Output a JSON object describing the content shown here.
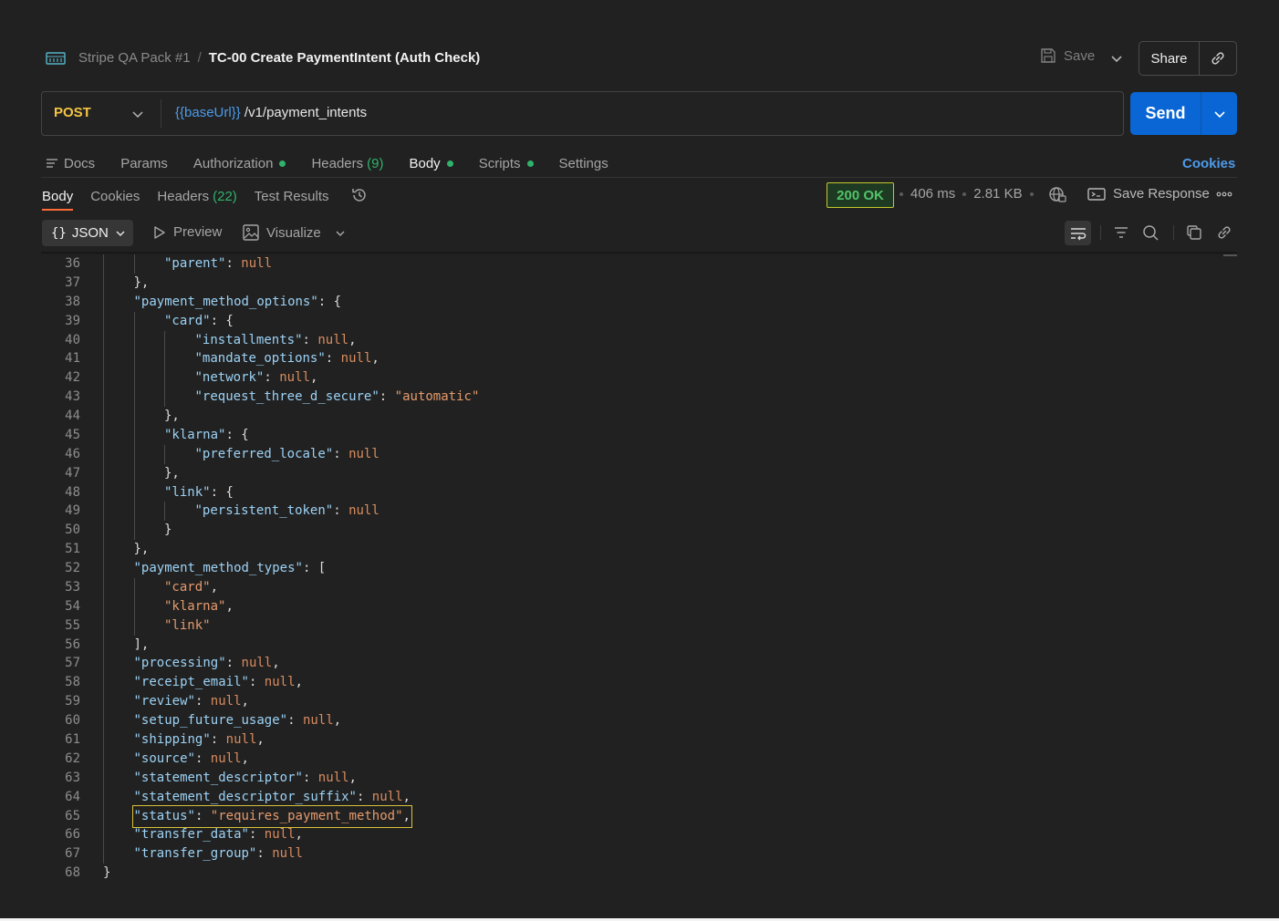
{
  "header": {
    "icon": "http-icon",
    "collection": "Stripe QA Pack #1",
    "separator": "/",
    "title": "TC-00 Create PaymentIntent (Auth Check)",
    "save_label": "Save",
    "share_label": "Share"
  },
  "request": {
    "method": "POST",
    "url_variable": "{{baseUrl}}",
    "url_path": "/v1/payment_intents",
    "send_label": "Send"
  },
  "request_tabs": {
    "docs": "Docs",
    "params": "Params",
    "authorization": "Authorization",
    "headers": "Headers",
    "headers_count": "(9)",
    "body": "Body",
    "scripts": "Scripts",
    "settings": "Settings",
    "cookies": "Cookies",
    "active": "Body",
    "dot_color": "#2fb26b"
  },
  "response_tabs": {
    "body": "Body",
    "cookies": "Cookies",
    "headers": "Headers",
    "headers_count": "(22)",
    "test_results": "Test Results",
    "active": "Body"
  },
  "response_meta": {
    "status": "200 OK",
    "time": "406 ms",
    "size": "2.81 KB",
    "save_response": "Save Response"
  },
  "body_toolbar": {
    "format_icon": "{}",
    "format": "JSON",
    "preview": "Preview",
    "visualize": "Visualize"
  },
  "editor": {
    "highlighted_line": 65,
    "lines": [
      {
        "n": "36",
        "indent": 2,
        "tokens": [
          {
            "t": "\"parent\"",
            "c": "key"
          },
          {
            "t": ": ",
            "c": "p"
          },
          {
            "t": "null",
            "c": "null"
          }
        ]
      },
      {
        "n": "37",
        "indent": 1,
        "tokens": [
          {
            "t": "},",
            "c": "p"
          }
        ]
      },
      {
        "n": "38",
        "indent": 1,
        "tokens": [
          {
            "t": "\"payment_method_options\"",
            "c": "key"
          },
          {
            "t": ": {",
            "c": "p"
          }
        ]
      },
      {
        "n": "39",
        "indent": 2,
        "tokens": [
          {
            "t": "\"card\"",
            "c": "key"
          },
          {
            "t": ": {",
            "c": "p"
          }
        ]
      },
      {
        "n": "40",
        "indent": 3,
        "tokens": [
          {
            "t": "\"installments\"",
            "c": "key"
          },
          {
            "t": ": ",
            "c": "p"
          },
          {
            "t": "null",
            "c": "null"
          },
          {
            "t": ",",
            "c": "p"
          }
        ]
      },
      {
        "n": "41",
        "indent": 3,
        "tokens": [
          {
            "t": "\"mandate_options\"",
            "c": "key"
          },
          {
            "t": ": ",
            "c": "p"
          },
          {
            "t": "null",
            "c": "null"
          },
          {
            "t": ",",
            "c": "p"
          }
        ]
      },
      {
        "n": "42",
        "indent": 3,
        "tokens": [
          {
            "t": "\"network\"",
            "c": "key"
          },
          {
            "t": ": ",
            "c": "p"
          },
          {
            "t": "null",
            "c": "null"
          },
          {
            "t": ",",
            "c": "p"
          }
        ]
      },
      {
        "n": "43",
        "indent": 3,
        "tokens": [
          {
            "t": "\"request_three_d_secure\"",
            "c": "key"
          },
          {
            "t": ": ",
            "c": "p"
          },
          {
            "t": "\"automatic\"",
            "c": "str"
          }
        ]
      },
      {
        "n": "44",
        "indent": 2,
        "tokens": [
          {
            "t": "},",
            "c": "p"
          }
        ]
      },
      {
        "n": "45",
        "indent": 2,
        "tokens": [
          {
            "t": "\"klarna\"",
            "c": "key"
          },
          {
            "t": ": {",
            "c": "p"
          }
        ]
      },
      {
        "n": "46",
        "indent": 3,
        "tokens": [
          {
            "t": "\"preferred_locale\"",
            "c": "key"
          },
          {
            "t": ": ",
            "c": "p"
          },
          {
            "t": "null",
            "c": "null"
          }
        ]
      },
      {
        "n": "47",
        "indent": 2,
        "tokens": [
          {
            "t": "},",
            "c": "p"
          }
        ]
      },
      {
        "n": "48",
        "indent": 2,
        "tokens": [
          {
            "t": "\"link\"",
            "c": "key"
          },
          {
            "t": ": {",
            "c": "p"
          }
        ]
      },
      {
        "n": "49",
        "indent": 3,
        "tokens": [
          {
            "t": "\"persistent_token\"",
            "c": "key"
          },
          {
            "t": ": ",
            "c": "p"
          },
          {
            "t": "null",
            "c": "null"
          }
        ]
      },
      {
        "n": "50",
        "indent": 2,
        "tokens": [
          {
            "t": "}",
            "c": "p"
          }
        ]
      },
      {
        "n": "51",
        "indent": 1,
        "tokens": [
          {
            "t": "},",
            "c": "p"
          }
        ]
      },
      {
        "n": "52",
        "indent": 1,
        "tokens": [
          {
            "t": "\"payment_method_types\"",
            "c": "key"
          },
          {
            "t": ": [",
            "c": "p"
          }
        ]
      },
      {
        "n": "53",
        "indent": 2,
        "tokens": [
          {
            "t": "\"card\"",
            "c": "str"
          },
          {
            "t": ",",
            "c": "p"
          }
        ]
      },
      {
        "n": "54",
        "indent": 2,
        "tokens": [
          {
            "t": "\"klarna\"",
            "c": "str"
          },
          {
            "t": ",",
            "c": "p"
          }
        ]
      },
      {
        "n": "55",
        "indent": 2,
        "tokens": [
          {
            "t": "\"link\"",
            "c": "str"
          }
        ]
      },
      {
        "n": "56",
        "indent": 1,
        "tokens": [
          {
            "t": "],",
            "c": "p"
          }
        ]
      },
      {
        "n": "57",
        "indent": 1,
        "tokens": [
          {
            "t": "\"processing\"",
            "c": "key"
          },
          {
            "t": ": ",
            "c": "p"
          },
          {
            "t": "null",
            "c": "null"
          },
          {
            "t": ",",
            "c": "p"
          }
        ]
      },
      {
        "n": "58",
        "indent": 1,
        "tokens": [
          {
            "t": "\"receipt_email\"",
            "c": "key"
          },
          {
            "t": ": ",
            "c": "p"
          },
          {
            "t": "null",
            "c": "null"
          },
          {
            "t": ",",
            "c": "p"
          }
        ]
      },
      {
        "n": "59",
        "indent": 1,
        "tokens": [
          {
            "t": "\"review\"",
            "c": "key"
          },
          {
            "t": ": ",
            "c": "p"
          },
          {
            "t": "null",
            "c": "null"
          },
          {
            "t": ",",
            "c": "p"
          }
        ]
      },
      {
        "n": "60",
        "indent": 1,
        "tokens": [
          {
            "t": "\"setup_future_usage\"",
            "c": "key"
          },
          {
            "t": ": ",
            "c": "p"
          },
          {
            "t": "null",
            "c": "null"
          },
          {
            "t": ",",
            "c": "p"
          }
        ]
      },
      {
        "n": "61",
        "indent": 1,
        "tokens": [
          {
            "t": "\"shipping\"",
            "c": "key"
          },
          {
            "t": ": ",
            "c": "p"
          },
          {
            "t": "null",
            "c": "null"
          },
          {
            "t": ",",
            "c": "p"
          }
        ]
      },
      {
        "n": "62",
        "indent": 1,
        "tokens": [
          {
            "t": "\"source\"",
            "c": "key"
          },
          {
            "t": ": ",
            "c": "p"
          },
          {
            "t": "null",
            "c": "null"
          },
          {
            "t": ",",
            "c": "p"
          }
        ]
      },
      {
        "n": "63",
        "indent": 1,
        "tokens": [
          {
            "t": "\"statement_descriptor\"",
            "c": "key"
          },
          {
            "t": ": ",
            "c": "p"
          },
          {
            "t": "null",
            "c": "null"
          },
          {
            "t": ",",
            "c": "p"
          }
        ]
      },
      {
        "n": "64",
        "indent": 1,
        "tokens": [
          {
            "t": "\"statement_descriptor_suffix\"",
            "c": "key"
          },
          {
            "t": ": ",
            "c": "p"
          },
          {
            "t": "null",
            "c": "null"
          },
          {
            "t": ",",
            "c": "p"
          }
        ]
      },
      {
        "n": "65",
        "indent": 1,
        "tokens": [
          {
            "t": "\"status\"",
            "c": "key"
          },
          {
            "t": ": ",
            "c": "p"
          },
          {
            "t": "\"requires_payment_method\"",
            "c": "str"
          },
          {
            "t": ",",
            "c": "p"
          }
        ]
      },
      {
        "n": "66",
        "indent": 1,
        "tokens": [
          {
            "t": "\"transfer_data\"",
            "c": "key"
          },
          {
            "t": ": ",
            "c": "p"
          },
          {
            "t": "null",
            "c": "null"
          },
          {
            "t": ",",
            "c": "p"
          }
        ]
      },
      {
        "n": "67",
        "indent": 1,
        "tokens": [
          {
            "t": "\"transfer_group\"",
            "c": "key"
          },
          {
            "t": ": ",
            "c": "p"
          },
          {
            "t": "null",
            "c": "null"
          }
        ]
      },
      {
        "n": "68",
        "indent": 0,
        "tokens": [
          {
            "t": "}",
            "c": "p"
          }
        ]
      }
    ]
  },
  "colors": {
    "accent": "#0a66d4",
    "method": "#f5c542",
    "status_ok": "#4fc46a",
    "active_tab_underline": "#ff6c37",
    "link": "#4d9bea"
  }
}
